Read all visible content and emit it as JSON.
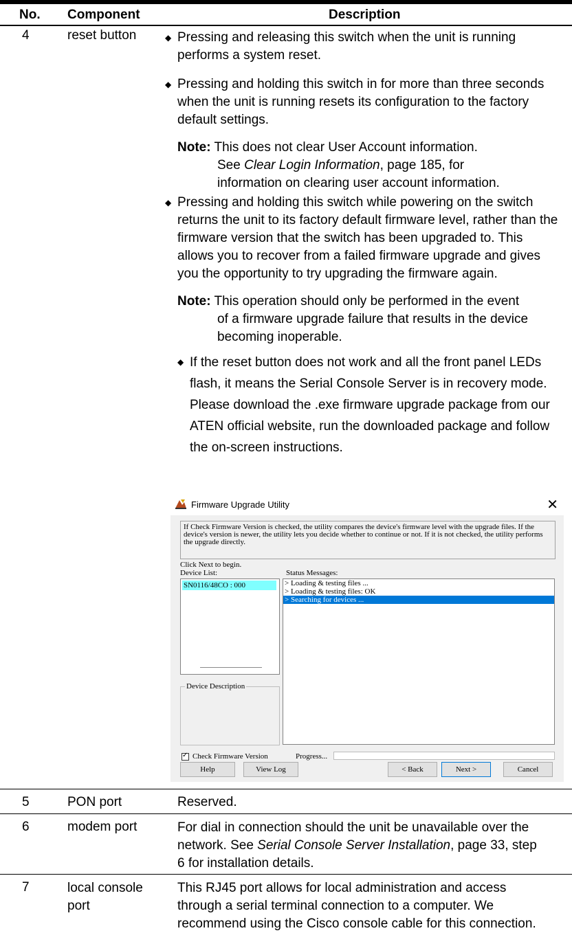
{
  "header": {
    "no": "No.",
    "component": "Component",
    "description": "Description"
  },
  "row4": {
    "no": "4",
    "component": "reset button",
    "bullets": [
      "Pressing and releasing this switch when the unit is running performs a system reset.",
      "Pressing and holding this switch in for more than three seconds when the unit is running resets its configuration to the factory default settings.",
      "Pressing and holding this switch while powering on the switch returns the unit to its factory default firmware level, rather than the firmware version that the switch has been upgraded to. This allows you to recover from a failed firmware upgrade and gives you the opportunity to try upgrading the firmware again.",
      "If the reset button does not work and all the front panel LEDs flash, it means the Serial Console Server is in recovery mode. Please download the .exe firmware upgrade package from our ATEN official website, run the downloaded package and follow the on-screen instructions."
    ],
    "note1": {
      "label": "Note:",
      "line1": "This does not clear User Account information.",
      "see": "See ",
      "link": "Clear Login Information",
      "rest": ", page 185, for",
      "line3": "information on clearing user account information."
    },
    "note2": {
      "label": "Note:",
      "line1": "This operation should only be performed in the event",
      "line2": "of a firmware upgrade failure that results in the device",
      "line3": "becoming inoperable."
    }
  },
  "dialog": {
    "title": "Firmware Upgrade Utility",
    "close": "✕",
    "intro": "If Check Firmware Version is checked, the utility compares the device's firmware level with the upgrade files. If the device's version is newer, the utility lets you decide whether to continue or not. If it is not checked, the utility performs the upgrade directly.",
    "click_next": "Click Next to begin.",
    "device_list_label": "Device List:",
    "device_item": "SN0116/48CO : 000",
    "status_label": "Status Messages:",
    "messages": [
      "> Loading & testing files ...",
      "> Loading & testing files: OK",
      "> Searching for devices ..."
    ],
    "device_desc_label": "Device Description",
    "check_label": "Check Firmware Version",
    "check_mark": "✓",
    "progress_label": "Progress...",
    "buttons": {
      "help": "Help",
      "view_log": "View Log",
      "back": "< Back",
      "next": "Next >",
      "cancel": "Cancel"
    }
  },
  "row5": {
    "no": "5",
    "component": "PON port",
    "description": "Reserved."
  },
  "row6": {
    "no": "6",
    "component": "modem port",
    "desc_line1": "For dial in connection should the unit be unavailable over the",
    "desc_pre": "network. See ",
    "desc_link": "Serial Console Server Installation",
    "desc_post": ", page 33, step",
    "desc_line3": "6 for installation details."
  },
  "row7": {
    "no": "7",
    "component_line1": "local console",
    "component_line2": "port",
    "desc_line1": "This RJ45 port allows for local administration and access",
    "desc_line2": "through a serial terminal connection to a computer. We",
    "desc_line3": "recommend using the Cisco console cable for this connection."
  }
}
